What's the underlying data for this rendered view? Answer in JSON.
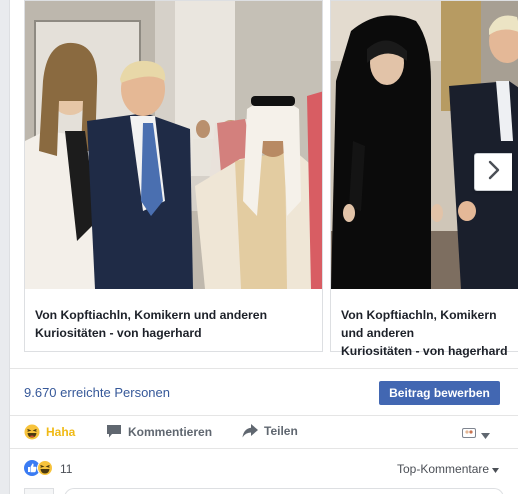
{
  "carousel": {
    "cards": [
      {
        "caption_line1": "Von Kopftiachln, Komikern und anderen",
        "caption_line2": "Kuriositäten - von hagerhard"
      },
      {
        "caption_line1": "Von Kopftiachln, Komikern und anderen",
        "caption_line2": "Kuriositäten - von hagerhard"
      }
    ],
    "next_icon": "chevron-right-icon"
  },
  "reach": {
    "text": "9.670 erreichte Personen",
    "boost_label": "Beitrag bewerben"
  },
  "actions": {
    "haha_label": "Haha",
    "comment_label": "Kommentieren",
    "share_label": "Teilen"
  },
  "reactions": {
    "count": "11",
    "top_comments_label": "Top-Kommentare"
  },
  "colors": {
    "link": "#365899",
    "primary_button": "#4267b2",
    "haha": "#f0ba15",
    "muted": "#606770"
  }
}
